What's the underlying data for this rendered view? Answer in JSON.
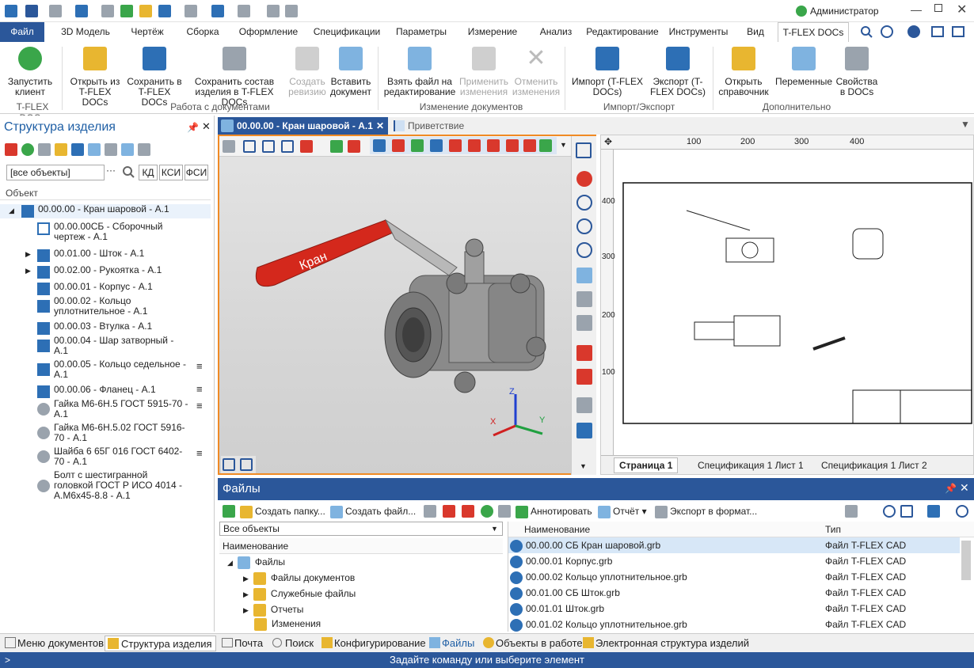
{
  "qat": {
    "user": "Администратор",
    "user_icon": "user-icon"
  },
  "tabs": {
    "file": "Файл",
    "model3d": "3D Модель",
    "drawing": "Чертёж",
    "assembly": "Сборка",
    "design": "Оформление",
    "specs": "Спецификации",
    "params": "Параметры",
    "measure": "Измерение",
    "analysis": "Анализ",
    "edit": "Редактирование",
    "tools": "Инструменты",
    "view": "Вид",
    "docs": "T-FLEX DOCs"
  },
  "ribbon": {
    "launch": "Запустить клиент",
    "open_from": "Открыть из T-FLEX DOCs",
    "save_to": "Сохранить в T-FLEX DOCs",
    "save_struct": "Сохранить состав изделия в T-FLEX DOCs",
    "create_rev": "Создать ревизию",
    "insert_doc": "Вставить документ",
    "take_edit": "Взять файл на редактирование",
    "apply": "Применить изменения",
    "cancel": "Отменить изменения",
    "import": "Импорт (T-FLEX DOCs)",
    "export": "Экспорт (T-FLEX DOCs)",
    "open_ref": "Открыть справочник",
    "vars": "Переменные",
    "props": "Свойства в DOCs",
    "g_docs": "T-FLEX DOCs",
    "g_work": "Работа с документами",
    "g_change": "Изменение документов",
    "g_ie": "Импорт/Экспорт",
    "g_extra": "Дополнительно"
  },
  "left": {
    "title": "Структура изделия",
    "filter": "[все объекты]",
    "btn_kd": "КД",
    "btn_ksi": "КСИ",
    "btn_fsi": "ФСИ",
    "col": "Объект",
    "items": [
      {
        "label": "00.00.00 - Кран шаровой - А.1"
      },
      {
        "label": "00.00.00СБ - Сборочный чертеж - А.1"
      },
      {
        "label": "00.01.00 - Шток - А.1"
      },
      {
        "label": "00.02.00 - Рукоятка - А.1"
      },
      {
        "label": "00.00.01 - Корпус - А.1"
      },
      {
        "label": "00.00.02 - Кольцо уплотнительное - А.1"
      },
      {
        "label": "00.00.03 - Втулка - А.1"
      },
      {
        "label": "00.00.04 - Шар затворный - А.1"
      },
      {
        "label": "00.00.05 - Кольцо седельное - А.1"
      },
      {
        "label": "00.00.06 - Фланец - А.1"
      },
      {
        "label": "Гайка М6-6Н.5 ГОСТ 5915-70 - А.1"
      },
      {
        "label": "Гайка М6-6Н.5.02 ГОСТ 5916-70 - А.1"
      },
      {
        "label": "Шайба 6 65Г 016 ГОСТ 6402-70 - А.1"
      },
      {
        "label": "Болт с шестигранной головкой ГОСТ Р ИСО 4014 - А.М6х45-8.8 - А.1"
      }
    ]
  },
  "doctabs": {
    "active": "00.00.00 - Кран шаровой - А.1",
    "welcome": "Приветствие"
  },
  "view3d": {
    "handle_text": "Кран",
    "axis_x": "X",
    "axis_y": "Y",
    "axis_z": "Z"
  },
  "view2d": {
    "ruler": [
      "100",
      "200",
      "300",
      "400"
    ],
    "ruler_v": [
      "400",
      "300",
      "200",
      "100"
    ],
    "pages": [
      "Страница 1",
      "Спецификация 1 Лист 1",
      "Спецификация 1 Лист 2"
    ]
  },
  "files": {
    "title": "Файлы",
    "tb_folder": "Создать папку...",
    "tb_file": "Создать файл...",
    "tb_annot": "Аннотировать",
    "tb_report": "Отчёт",
    "tb_export": "Экспорт в формат...",
    "filter": "Все объекты",
    "col_name": "Наименование",
    "col_type": "Тип",
    "tree": [
      "Файлы",
      "Файлы документов",
      "Служебные файлы",
      "Отчеты",
      "Изменения"
    ],
    "rows": [
      {
        "name": "00.00.00 СБ Кран шаровой.grb",
        "type": "Файл T-FLEX CAD"
      },
      {
        "name": "00.00.01 Корпус.grb",
        "type": "Файл T-FLEX CAD"
      },
      {
        "name": "00.00.02 Кольцо уплотнительное.grb",
        "type": "Файл T-FLEX CAD"
      },
      {
        "name": "00.01.00 СБ Шток.grb",
        "type": "Файл T-FLEX CAD"
      },
      {
        "name": "00.01.01 Шток.grb",
        "type": "Файл T-FLEX CAD"
      },
      {
        "name": "00.01.02 Кольцо уплотнительное.grb",
        "type": "Файл T-FLEX CAD"
      }
    ]
  },
  "bottomtabs": {
    "menu": "Меню документов",
    "struct": "Структура изделия",
    "mail": "Почта",
    "search": "Поиск",
    "config": "Конфигурирование",
    "files": "Файлы",
    "work": "Объекты в работе",
    "estruct": "Электронная структура изделий"
  },
  "status": "Задайте команду или выберите элемент"
}
